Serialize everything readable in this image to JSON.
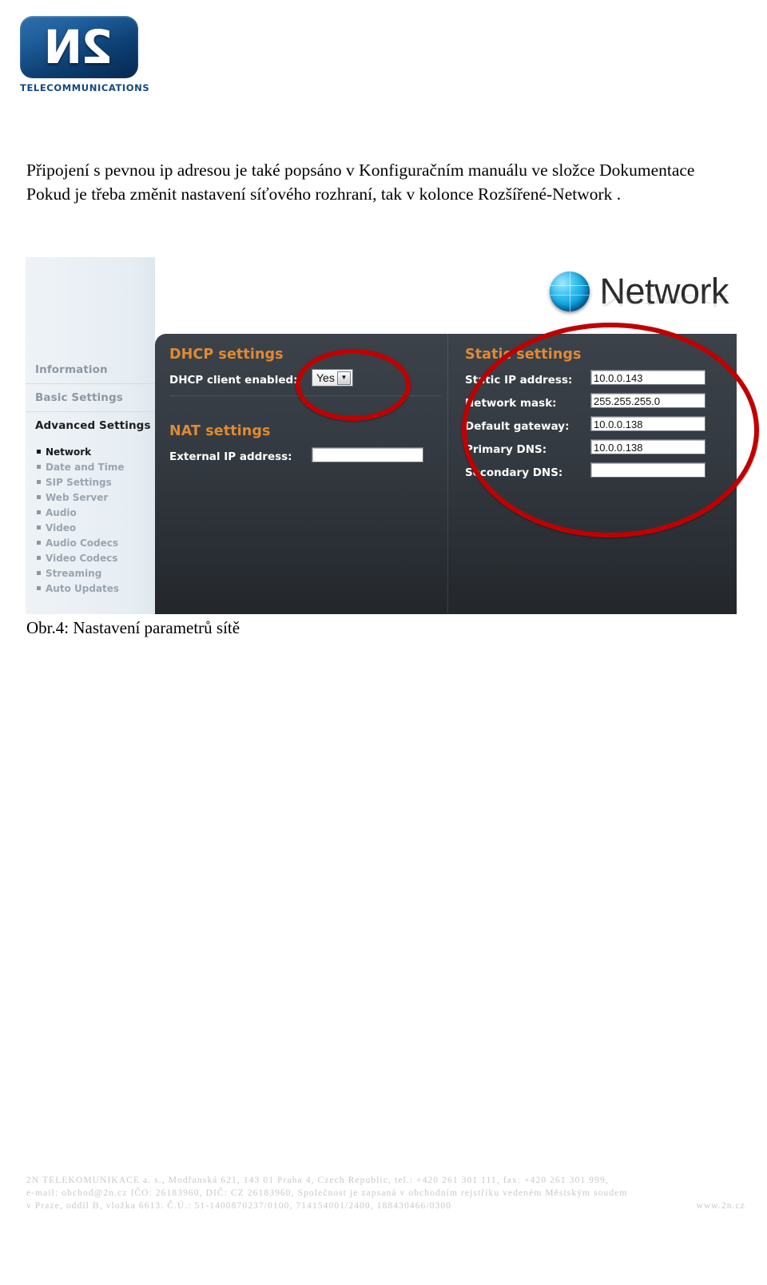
{
  "brand": {
    "logo_mark": "2N",
    "logo_word": "TELECOMMUNICATIONS"
  },
  "document": {
    "paragraph_1": "Připojení s pevnou ip adresou je také popsáno v Konfiguračním manuálu ve složce Dokumentace",
    "paragraph_2": "Pokud je třeba změnit nastavení síťového rozhraní, tak v kolonce Rozšířené-Network .",
    "figure_caption": "Obr.4: Nastavení parametrů sítě"
  },
  "screenshot": {
    "page_title": "Network",
    "globe_icon": "globe-icon",
    "sidebar": {
      "major_items": [
        {
          "label": "Information",
          "current": false
        },
        {
          "label": "Basic Settings",
          "current": false
        },
        {
          "label": "Advanced Settings",
          "current": true
        }
      ],
      "sub_items": [
        {
          "label": "Network",
          "active": true
        },
        {
          "label": "Date and Time",
          "active": false
        },
        {
          "label": "SIP Settings",
          "active": false
        },
        {
          "label": "Web Server",
          "active": false
        },
        {
          "label": "Audio",
          "active": false
        },
        {
          "label": "Video",
          "active": false
        },
        {
          "label": "Audio Codecs",
          "active": false
        },
        {
          "label": "Video Codecs",
          "active": false
        },
        {
          "label": "Streaming",
          "active": false
        },
        {
          "label": "Auto Updates",
          "active": false
        }
      ]
    },
    "dhcp_settings": {
      "section_title": "DHCP settings",
      "client_enabled_label": "DHCP client enabled:",
      "client_enabled_value": "Yes",
      "dropdown_arrow": "▼"
    },
    "nat_settings": {
      "section_title": "NAT settings",
      "external_ip_label": "External IP address:",
      "external_ip_value": ""
    },
    "static_settings": {
      "section_title": "Static settings",
      "fields": [
        {
          "label": "Static IP address:",
          "value": "10.0.0.143"
        },
        {
          "label": "Network mask:",
          "value": "255.255.255.0"
        },
        {
          "label": "Default gateway:",
          "value": "10.0.0.138"
        },
        {
          "label": "Primary DNS:",
          "value": "10.0.0.138"
        },
        {
          "label": "Secondary DNS:",
          "value": ""
        }
      ]
    },
    "annotations": {
      "highlight_color": "#c00000",
      "accent_color": "#e08a34"
    }
  },
  "footer": {
    "line_1": "2N TELEKOMUNIKACE a. s., Modřanská 621, 143 01 Praha 4, Czech Republic, tel.: +420 261 301 111, fax: +420 261 301 999,",
    "line_2": "e-mail: obchod@2n.cz   IČO: 26183960, DIČ: CZ 26183960, Společnost je zapsaná v obchodním rejstříku vedeném Městským soudem",
    "line_3": "v Praze, oddíl B, vložka 6613. Č.Ú.: 51-1400870237/0100,  714154001/2400,  188430466/0300",
    "website": "www.2n.cz"
  }
}
